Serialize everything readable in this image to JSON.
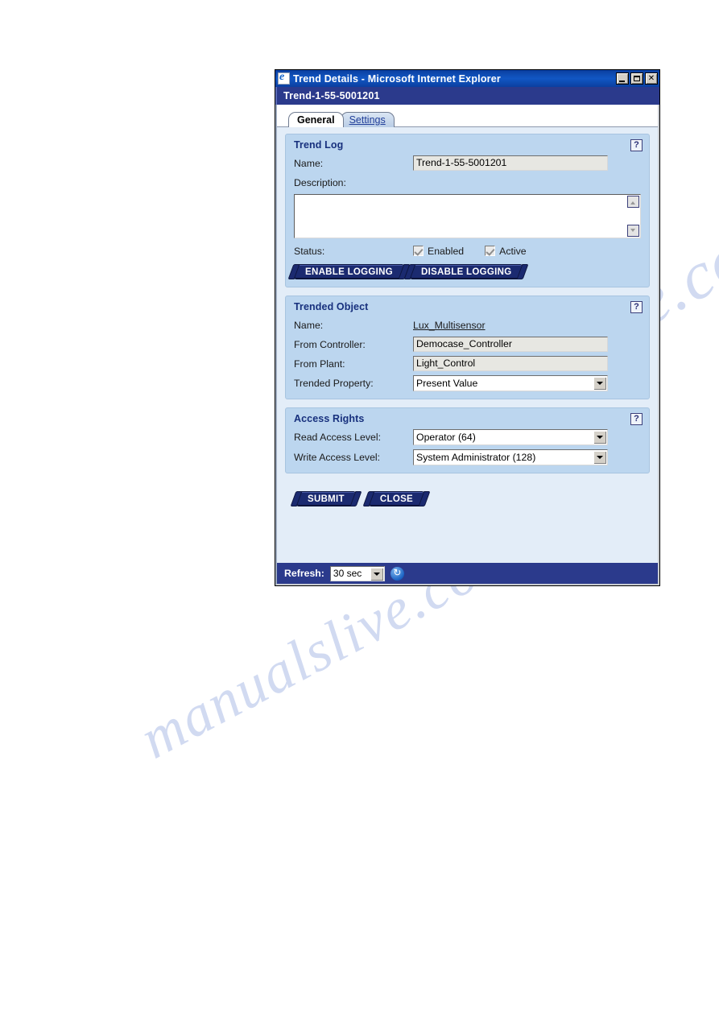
{
  "window": {
    "title": "Trend Details - Microsoft Internet Explorer",
    "app_icon": "internet-explorer-icon",
    "minimize_label": "_",
    "maximize_label": "□",
    "close_label": "✕",
    "header_title": "Trend-1-55-5001201"
  },
  "tabs": [
    {
      "label": "General",
      "active": true
    },
    {
      "label": "Settings",
      "active": false
    }
  ],
  "trend_log": {
    "panel_title": "Trend Log",
    "help_label": "?",
    "name_label": "Name:",
    "name_value": "Trend-1-55-5001201",
    "description_label": "Description:",
    "description_value": "",
    "status_label": "Status:",
    "enabled_label": "Enabled",
    "enabled_checked": true,
    "active_label": "Active",
    "active_checked": true,
    "enable_logging_label": "ENABLE LOGGING",
    "disable_logging_label": "DISABLE LOGGING"
  },
  "trended_object": {
    "panel_title": "Trended Object",
    "help_label": "?",
    "name_label": "Name:",
    "name_value": "Lux_Multisensor",
    "controller_label": "From Controller:",
    "controller_value": "Democase_Controller",
    "plant_label": "From Plant:",
    "plant_value": "Light_Control",
    "property_label": "Trended Property:",
    "property_value": "Present Value"
  },
  "access_rights": {
    "panel_title": "Access Rights",
    "help_label": "?",
    "read_label": "Read Access Level:",
    "read_value": "Operator (64)",
    "write_label": "Write Access Level:",
    "write_value": "System Administrator (128)"
  },
  "actions": {
    "submit_label": "SUBMIT",
    "close_label": "CLOSE"
  },
  "footer": {
    "refresh_label": "Refresh:",
    "refresh_value": "30 sec",
    "refresh_icon": "refresh-icon"
  },
  "watermarks": {
    "line1": "manualslive.com",
    "line2": "manualslive.com"
  },
  "colors": {
    "title_blue": "#0b3fa0",
    "header_navy": "#2b3a8c",
    "panel_blue": "#bcd6ef",
    "page_blue": "#e3edf8",
    "button_navy": "#1b2a70",
    "panel_title_text": "#17307d"
  }
}
